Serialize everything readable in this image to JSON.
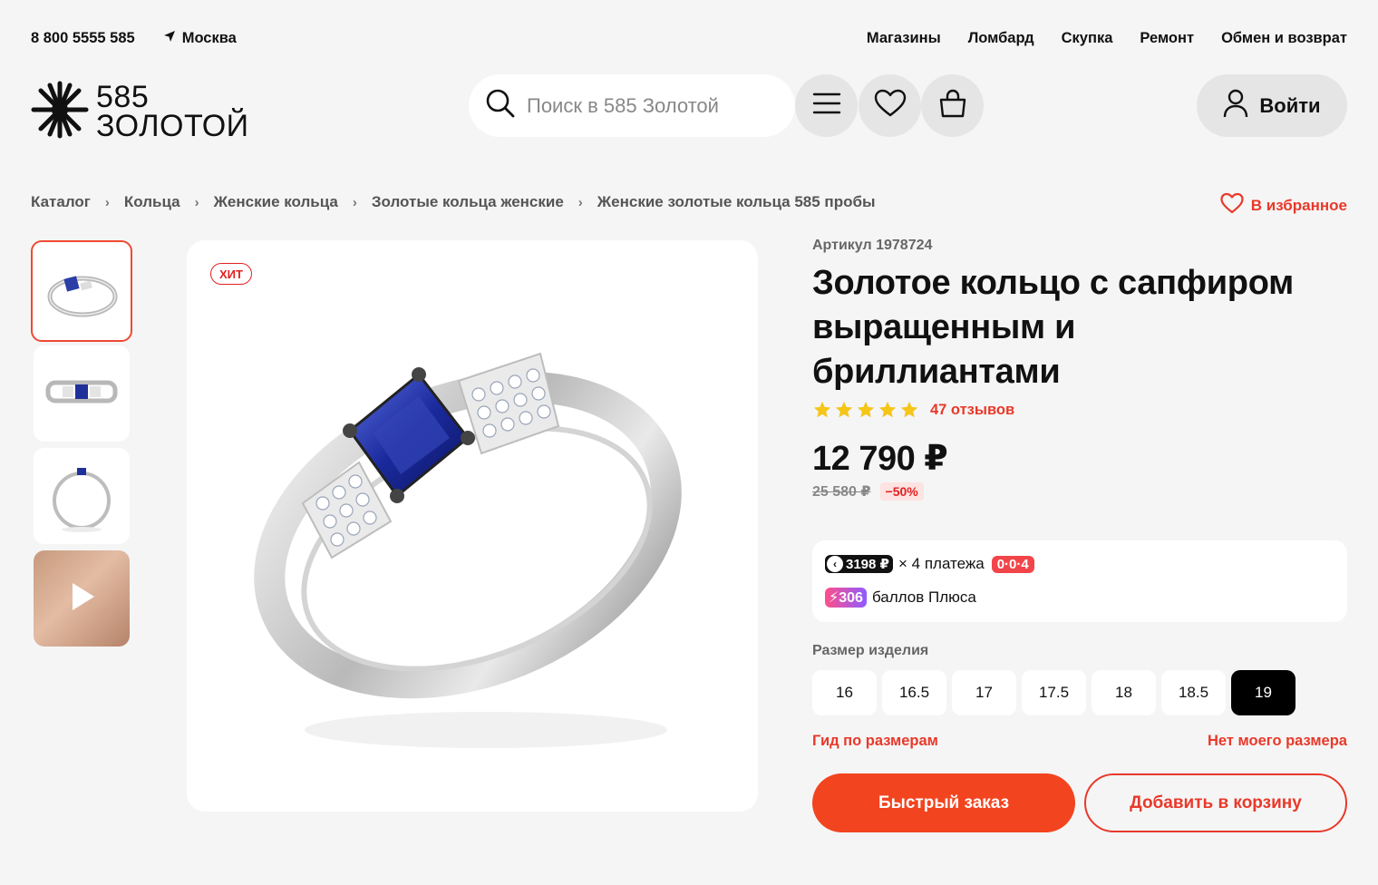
{
  "topbar": {
    "phone": "8 800 5555 585",
    "city": "Москва",
    "links": [
      "Магазины",
      "Ломбард",
      "Скупка",
      "Ремонт",
      "Обмен и возврат"
    ]
  },
  "header": {
    "logo_line1": "585",
    "logo_line2": "ЗОЛОТОЙ",
    "search_placeholder": "Поиск в 585 Золотой",
    "login_label": "Войти"
  },
  "breadcrumb": [
    "Каталог",
    "Кольца",
    "Женские кольца",
    "Золотые кольца женские",
    "Женские золотые кольца 585 пробы"
  ],
  "favorite_label": "В избранное",
  "gallery": {
    "badge": "ХИТ"
  },
  "product": {
    "article": "Артикул 1978724",
    "title_line1": "Золотое кольцо с сапфиром",
    "title_line2": "выращенным и",
    "title_line3": "бриллиантами",
    "rating": 5,
    "reviews": "47 отзывов",
    "price": "12 790 ₽",
    "old_price": "25 580 ₽",
    "discount": "−50%"
  },
  "payment": {
    "split_amount": "3198 ₽",
    "split_text": "× 4 платежа",
    "split_tag": "0·0·4",
    "plus_amount": "306",
    "plus_text": "баллов Плюса"
  },
  "sizes": {
    "label": "Размер изделия",
    "options": [
      "16",
      "16.5",
      "17",
      "17.5",
      "18",
      "18.5",
      "19"
    ],
    "selected": "19",
    "guide_link": "Гид по размерам",
    "missing_link": "Нет моего размера"
  },
  "actions": {
    "quick_order": "Быстрый заказ",
    "add_to_cart": "Добавить в корзину"
  },
  "colors": {
    "accent": "#f2441f",
    "link": "#e8392a",
    "star": "#f5c518"
  }
}
